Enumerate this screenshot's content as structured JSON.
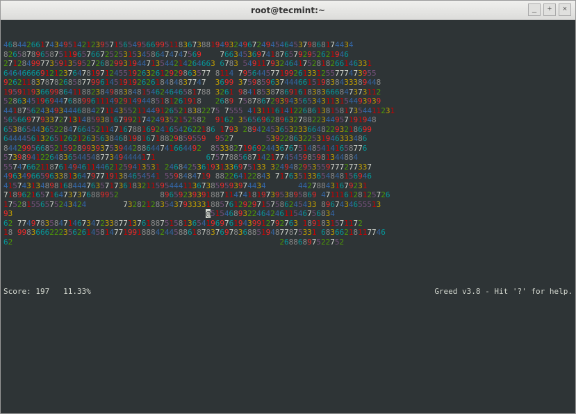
{
  "window": {
    "title": "root@tecmint:~",
    "controls": {
      "min": "_",
      "max": "+",
      "close": "×"
    }
  },
  "grid": {
    "cols": 79,
    "rows": [
      "4684426617434951421239571565495669951183673881949324967249454645379868174434",
      "8265878965875119657667252531534586474747569    7663453697418765792952621946",
      "2712849977359135952726829931944713544214264663 6783 5491179324641752818266146331",
      "646466669121237647819712455192632612929863577 8114 795644577199261331255777473955",
      "92621183787826858779961451919262618484837747  3699 3759859637444661519838433389448",
      "195911936699864118823849883848154624646581788 3261 9841853878691618383666847373112",
      "5286345196944768899611149291494485181261918   2689 7587867293943565343113154493939",
      "44187562434934446884271143552114491265218382275 7555 41311161412268613815817354411231",
      "56566977933727131485938167992174249352152582  9162 356569628963278822344957191948",
      "6538654436522847664521147167881692416542622186 1793 2894245365323366482293218699",
      "64444561326512621263563846819816718829859559  9527       5392286322531946333486",
      "8442995668521592899393753944288644741664492  8533827196924436767514854141658776",
      "573989412264836544548773494444171           675778856871421774545985981344884",
      "5574766211876149461144621259413531 2468425361931336975133 3249482953559777277337",
      "4963496659633813647977191384654541 5598484719 882264122843 717635133654848156946",
      "415743134898168444763571736183211595444113673859593974434       442788431679231",
      "7189621657164737376889952         8965923939188711474181973953895869 471116128125726",
      "175281556575243424        732821283543793333188576129297157586245433 8967434655513",
      "93                                          @515468932246424611546756834",
      "62 7749783584714673472338771376188751581365419697619439912792763 1891831571172",
      "18 99836662223562614581477199188842445886187837697836885194877875331 68366218117746",
      "62                                                          26886897522752",
      "",
      ""
    ]
  },
  "status": {
    "score_label": "Score:",
    "score_value": "197",
    "percent": "11.33%",
    "help": "Greed v3.8 - Hit '?' for help."
  }
}
